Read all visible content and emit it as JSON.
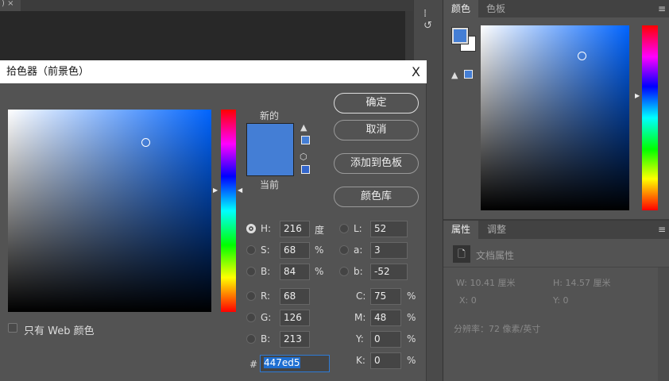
{
  "document": {
    "tab_close": "×"
  },
  "color_panel": {
    "tabs": [
      "颜色",
      "色板"
    ],
    "menu": "≡",
    "foreground": "#447ed5",
    "background": "#ffffff"
  },
  "properties_panel": {
    "tabs": [
      "属性",
      "调整"
    ],
    "menu": "≡",
    "section": "文档属性",
    "w_label": "W:",
    "w_value": "10.41",
    "w_unit": "厘米",
    "h_label": "H:",
    "h_value": "14.57",
    "h_unit": "厘米",
    "x_label": "X:",
    "x_value": "0",
    "y_label": "Y:",
    "y_value": "0",
    "resolution": "分辨率：72 像素/英寸"
  },
  "dialog": {
    "title": "拾色器（前景色）",
    "close": "X",
    "new_label": "新的",
    "current_label": "当前",
    "new_color": "#447ed5",
    "current_color": "#447ed5",
    "buttons": {
      "ok": "确定",
      "cancel": "取消",
      "add_swatch": "添加到色板",
      "libraries": "颜色库"
    },
    "web_only_label": "只有 Web 颜色",
    "web_only_checked": false,
    "hsb": [
      {
        "label": "H:",
        "value": "216",
        "unit": "度",
        "selected": true
      },
      {
        "label": "S:",
        "value": "68",
        "unit": "%"
      },
      {
        "label": "B:",
        "value": "84",
        "unit": "%"
      }
    ],
    "lab": [
      {
        "label": "L:",
        "value": "52"
      },
      {
        "label": "a:",
        "value": "3"
      },
      {
        "label": "b:",
        "value": "-52"
      }
    ],
    "rgb": [
      {
        "label": "R:",
        "value": "68"
      },
      {
        "label": "G:",
        "value": "126"
      },
      {
        "label": "B:",
        "value": "213"
      }
    ],
    "cmyk": [
      {
        "label": "C:",
        "value": "75",
        "unit": "%"
      },
      {
        "label": "M:",
        "value": "48",
        "unit": "%"
      },
      {
        "label": "Y:",
        "value": "0",
        "unit": "%"
      },
      {
        "label": "K:",
        "value": "0",
        "unit": "%"
      }
    ],
    "hex_label": "#",
    "hex": "447ed5"
  }
}
